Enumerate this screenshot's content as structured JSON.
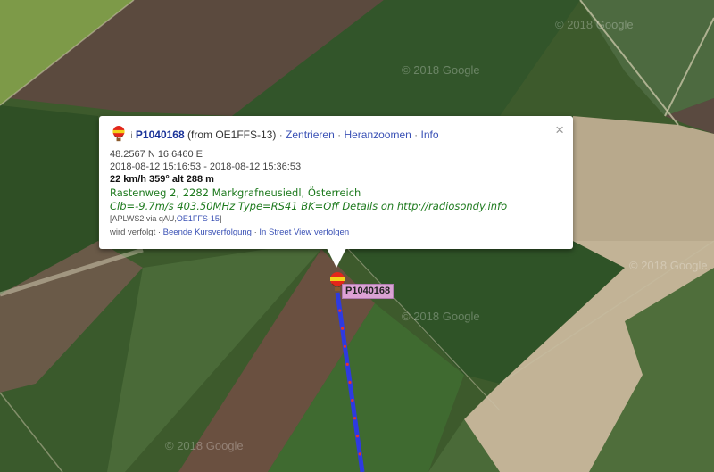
{
  "watermarks": [
    "© 2018 Google",
    "© 2018 Google",
    "© 2018 Google",
    "© 2018 Google",
    "© 2018 Google"
  ],
  "popup": {
    "icon": "balloon-icon",
    "prefix": "i",
    "callsign": "P1040168",
    "from_text": "(from OE1FFS-13)",
    "links": {
      "center": "Zentrieren",
      "zoom": "Heranzoomen",
      "info": "Info"
    },
    "separator": "·",
    "close_icon": "close-icon",
    "close_label": "×",
    "coordinates": "48.2567 N 16.6460 E",
    "time_range": "2018-08-12 15:16:53 - 2018-08-12 15:36:53",
    "speed_alt": "22 km/h 359° alt 288 m",
    "address": "Rastenweg 2, 2282 Markgrafneusiedl, Österreich",
    "comment": "Clb=-9.7m/s 403.50MHz Type=RS41 BK=Off Details on http://radiosondy.info",
    "path": {
      "prefix": "[APLWS2 via qAU,",
      "link": "OE1FFS-15",
      "suffix": "]"
    },
    "follow": {
      "status": "wird verfolgt",
      "stop": "Beende Kursverfolgung",
      "streetview": "In Street View verfolgen"
    }
  },
  "marker": {
    "label": "P1040168",
    "icon": "balloon-icon"
  },
  "track": {
    "color": "#2e3ae0",
    "dot_color": "#e8332b"
  },
  "colors": {
    "link": "#3a51b5",
    "callsign": "#1a3399",
    "address": "#1e7a1e",
    "label_bg": "#ebaae6"
  }
}
